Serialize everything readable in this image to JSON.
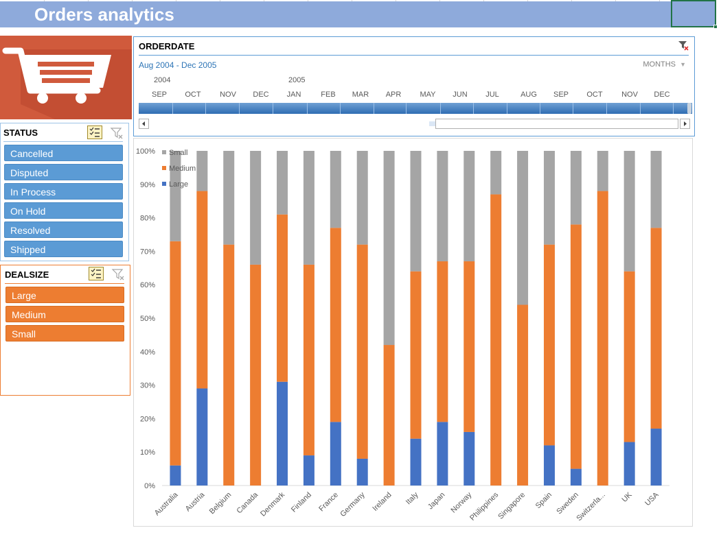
{
  "title": "Orders analytics",
  "colors": {
    "title_bar": "#8eaadb",
    "status_item": "#5b9bd5",
    "dealsize_item": "#ed7d31",
    "logo_bg": "#d05a3c",
    "large": "#4472c4",
    "medium": "#ed7d31",
    "small": "#a5a5a5"
  },
  "logo": {
    "icon": "shopping-cart-icon"
  },
  "status_slicer": {
    "header": "STATUS",
    "items": [
      "Cancelled",
      "Disputed",
      "In Process",
      "On Hold",
      "Resolved",
      "Shipped"
    ],
    "multi_select_icon": "multi-select-icon",
    "clear_filter_icon": "clear-filter-icon"
  },
  "dealsize_slicer": {
    "header": "DEALSIZE",
    "items": [
      "Large",
      "Medium",
      "Small"
    ],
    "multi_select_icon": "multi-select-icon",
    "clear_filter_icon": "clear-filter-icon"
  },
  "timeline": {
    "header": "ORDERDATE",
    "range_label": "Aug 2004 - Dec 2005",
    "level": "MONTHS",
    "years": [
      "2004",
      "2005"
    ],
    "months": [
      "SEP",
      "OCT",
      "NOV",
      "DEC",
      "JAN",
      "FEB",
      "MAR",
      "APR",
      "MAY",
      "JUN",
      "JUL",
      "AUG",
      "SEP",
      "OCT",
      "NOV",
      "DEC"
    ],
    "clear_filter_icon": "clear-filter-icon"
  },
  "chart_data": {
    "type": "bar",
    "stacked": "percent",
    "categories": [
      "Australia",
      "Austria",
      "Belgium",
      "Canada",
      "Denmark",
      "Finland",
      "France",
      "Germany",
      "Ireland",
      "Italy",
      "Japan",
      "Norway",
      "Philippines",
      "Singapore",
      "Spain",
      "Sweden",
      "Switzerla...",
      "UK",
      "USA"
    ],
    "series": [
      {
        "name": "Large",
        "values": [
          6,
          29,
          0,
          0,
          31,
          9,
          19,
          8,
          0,
          14,
          19,
          16,
          0,
          0,
          12,
          5,
          0,
          13,
          17
        ]
      },
      {
        "name": "Medium",
        "values": [
          67,
          59,
          72,
          66,
          50,
          57,
          58,
          64,
          42,
          50,
          48,
          51,
          87,
          54,
          60,
          73,
          88,
          51,
          60
        ]
      },
      {
        "name": "Small",
        "values": [
          27,
          12,
          28,
          34,
          19,
          34,
          23,
          28,
          58,
          36,
          33,
          33,
          13,
          46,
          28,
          22,
          12,
          36,
          23
        ]
      }
    ],
    "legend_order": [
      "Small",
      "Medium",
      "Large"
    ],
    "ylim": [
      0,
      100
    ],
    "yticks": [
      "0%",
      "10%",
      "20%",
      "30%",
      "40%",
      "50%",
      "60%",
      "70%",
      "80%",
      "90%",
      "100%"
    ],
    "legend_position": "top-left"
  }
}
